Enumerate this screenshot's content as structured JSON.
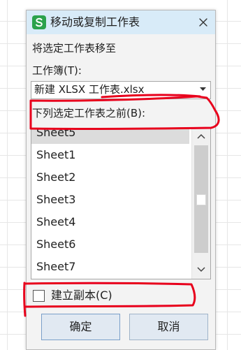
{
  "dialog": {
    "title": "移动或复制工作表",
    "prompt": "将选定工作表移至",
    "workbook_label": "工作簿(T):",
    "workbook_value": "新建 XLSX 工作表.xlsx",
    "before_label": "下列选定工作表之前(B):",
    "sheets": [
      "Sheet5",
      "Sheet1",
      "Sheet2",
      "Sheet3",
      "Sheet4",
      "Sheet6",
      "Sheet7"
    ],
    "selected_sheet": "Sheet5",
    "copy_checkbox_label": "建立副本(C)",
    "copy_checked": false,
    "ok_label": "确定",
    "cancel_label": "取消"
  },
  "icons": {
    "app": "wps-spreadsheet-icon",
    "close": "close-icon",
    "dropdown": "chevron-down-icon",
    "scroll_up": "chevron-up-icon",
    "scroll_down": "chevron-down-icon"
  },
  "colors": {
    "titlebar": "#d8ebf8",
    "app_icon": "#2ba24c",
    "annotation": "#e8001c",
    "button": "#e1e9f2"
  }
}
